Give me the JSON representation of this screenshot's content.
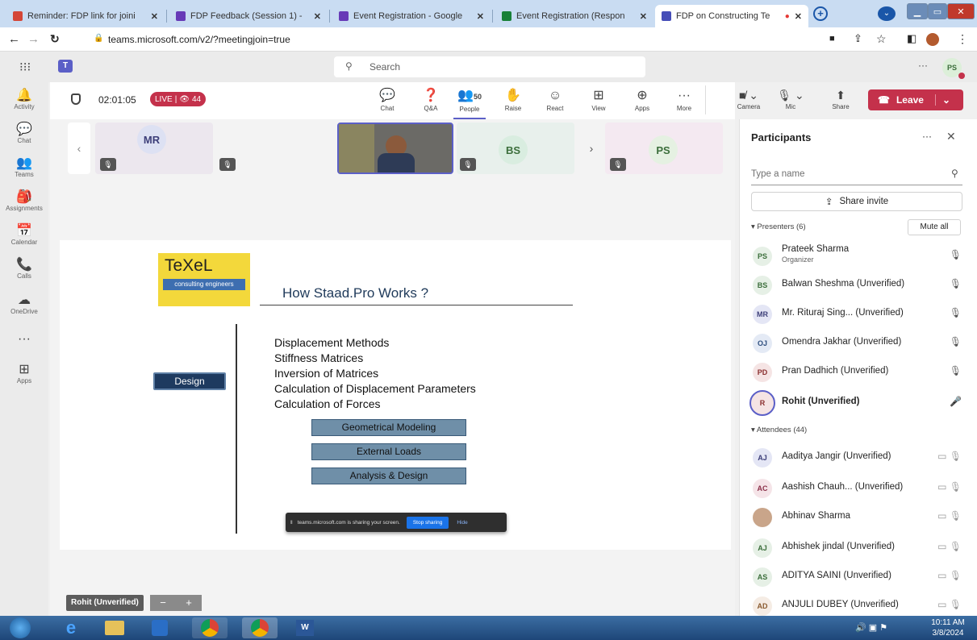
{
  "browser": {
    "tabs": [
      {
        "title": "Reminder: FDP link for joini",
        "color": "#d44638"
      },
      {
        "title": "FDP Feedback (Session 1) -",
        "color": "#673ab7"
      },
      {
        "title": "Event Registration - Google",
        "color": "#673ab7"
      },
      {
        "title": "Event Registration (Respon",
        "color": "#188038"
      },
      {
        "title": "FDP on Constructing Te",
        "color": "#464eb8"
      }
    ],
    "new_tab": "+",
    "url": "teams.microsoft.com/v2/?meetingjoin=true"
  },
  "teams": {
    "search_placeholder": "Search",
    "more": "···",
    "user_initials": "PS",
    "rail": [
      {
        "label": "Activity",
        "icon": "bell-icon",
        "glyph": "🔔"
      },
      {
        "label": "Chat",
        "icon": "chat-icon",
        "glyph": "💬"
      },
      {
        "label": "Teams",
        "icon": "teams-icon",
        "glyph": "👥"
      },
      {
        "label": "Assignments",
        "icon": "assignments-icon",
        "glyph": "🎒"
      },
      {
        "label": "Calendar",
        "icon": "calendar-icon",
        "glyph": "📅"
      },
      {
        "label": "Calls",
        "icon": "calls-icon",
        "glyph": "📞"
      },
      {
        "label": "OneDrive",
        "icon": "cloud-icon",
        "glyph": "☁"
      },
      {
        "label": "",
        "icon": "more-icon",
        "glyph": "···"
      },
      {
        "label": "Apps",
        "icon": "apps-icon",
        "glyph": "⊞"
      }
    ]
  },
  "meeting": {
    "timer": "02:01:05",
    "live_label": "LIVE",
    "viewer_count": "44",
    "tools": [
      {
        "label": "Chat",
        "glyph": "💬",
        "badge": ""
      },
      {
        "label": "Q&A",
        "glyph": "❓",
        "badge": ""
      },
      {
        "label": "People",
        "glyph": "👥",
        "badge": "50"
      },
      {
        "label": "Raise",
        "glyph": "✋",
        "badge": ""
      },
      {
        "label": "React",
        "glyph": "☺",
        "badge": ""
      },
      {
        "label": "View",
        "glyph": "⊞",
        "badge": ""
      },
      {
        "label": "Apps",
        "glyph": "⊕",
        "badge": ""
      },
      {
        "label": "More",
        "glyph": "···",
        "badge": ""
      }
    ],
    "camera": "Camera",
    "mic": "Mic",
    "share": "Share",
    "leave": "Leave"
  },
  "tiles": [
    {
      "initials": "MR"
    },
    {
      "initials": "BS"
    },
    {
      "initials": "PS"
    }
  ],
  "slide": {
    "logo_name": "TeXeL",
    "logo_sub": "consulting engineers",
    "heading": "How Staad.Pro Works ?",
    "design_label": "Design",
    "lines": [
      "Displacement Methods",
      "Stiffness Matrices",
      "Inversion of Matrices",
      "Calculation of Displacement Parameters",
      "Calculation of Forces"
    ],
    "boxes": [
      "Geometrical Modeling",
      "External Loads",
      "Analysis & Design"
    ],
    "share_msg": "teams.microsoft.com is sharing your screen.",
    "stop_sharing": "Stop sharing",
    "hide": "Hide"
  },
  "pinned_name": "Rohit (Unverified)",
  "panel": {
    "title": "Participants",
    "more": "···",
    "search_placeholder": "Type a name",
    "share_invite": "Share invite",
    "presenters_header": "Presenters (6)",
    "mute_all": "Mute all",
    "presenters": [
      {
        "initials": "PS",
        "name": "Prateek Sharma",
        "sub": "Organizer",
        "color": "#e6f0e6",
        "tc": "#3b6e3b"
      },
      {
        "initials": "BS",
        "name": "Balwan Sheshma (Unverified)",
        "sub": "",
        "color": "#e6f0e6",
        "tc": "#3b6e3b"
      },
      {
        "initials": "MR",
        "name": "Mr. Rituraj Sing... (Unverified)",
        "sub": "",
        "color": "#e4e6f5",
        "tc": "#3d3f79"
      },
      {
        "initials": "OJ",
        "name": "Omendra Jakhar (Unverified)",
        "sub": "",
        "color": "#e4eaf5",
        "tc": "#2f4f7f"
      },
      {
        "initials": "PD",
        "name": "Pran Dadhich (Unverified)",
        "sub": "",
        "color": "#f5e4e4",
        "tc": "#8a2f2f"
      },
      {
        "initials": "R",
        "name": "Rohit (Unverified)",
        "sub": "",
        "color": "#f5e4e4",
        "tc": "#8a2f2f"
      }
    ],
    "attendees_header": "Attendees (44)",
    "attendees": [
      {
        "initials": "AJ",
        "name": "Aaditya Jangir (Unverified)",
        "color": "#e4e6f5",
        "tc": "#3d3f79"
      },
      {
        "initials": "AC",
        "name": "Aashish Chauh... (Unverified)",
        "color": "#f5e4e8",
        "tc": "#8a2f48"
      },
      {
        "initials": "",
        "name": "Abhinav Sharma",
        "color": "#c9a58a",
        "tc": "#fff"
      },
      {
        "initials": "AJ",
        "name": "Abhishek jindal (Unverified)",
        "color": "#e6f0e6",
        "tc": "#3b6e3b"
      },
      {
        "initials": "AS",
        "name": "ADITYA SAINI (Unverified)",
        "color": "#e6f0e6",
        "tc": "#3b6e3b"
      },
      {
        "initials": "AD",
        "name": "ANJULI DUBEY (Unverified)",
        "color": "#f5ece4",
        "tc": "#8a5a2f"
      }
    ]
  },
  "taskbar": {
    "time": "10:11 AM",
    "date": "3/8/2024"
  },
  "colors": {
    "accent": "#5b5fc7",
    "live": "#c4314b",
    "leave": "#c4314b"
  }
}
